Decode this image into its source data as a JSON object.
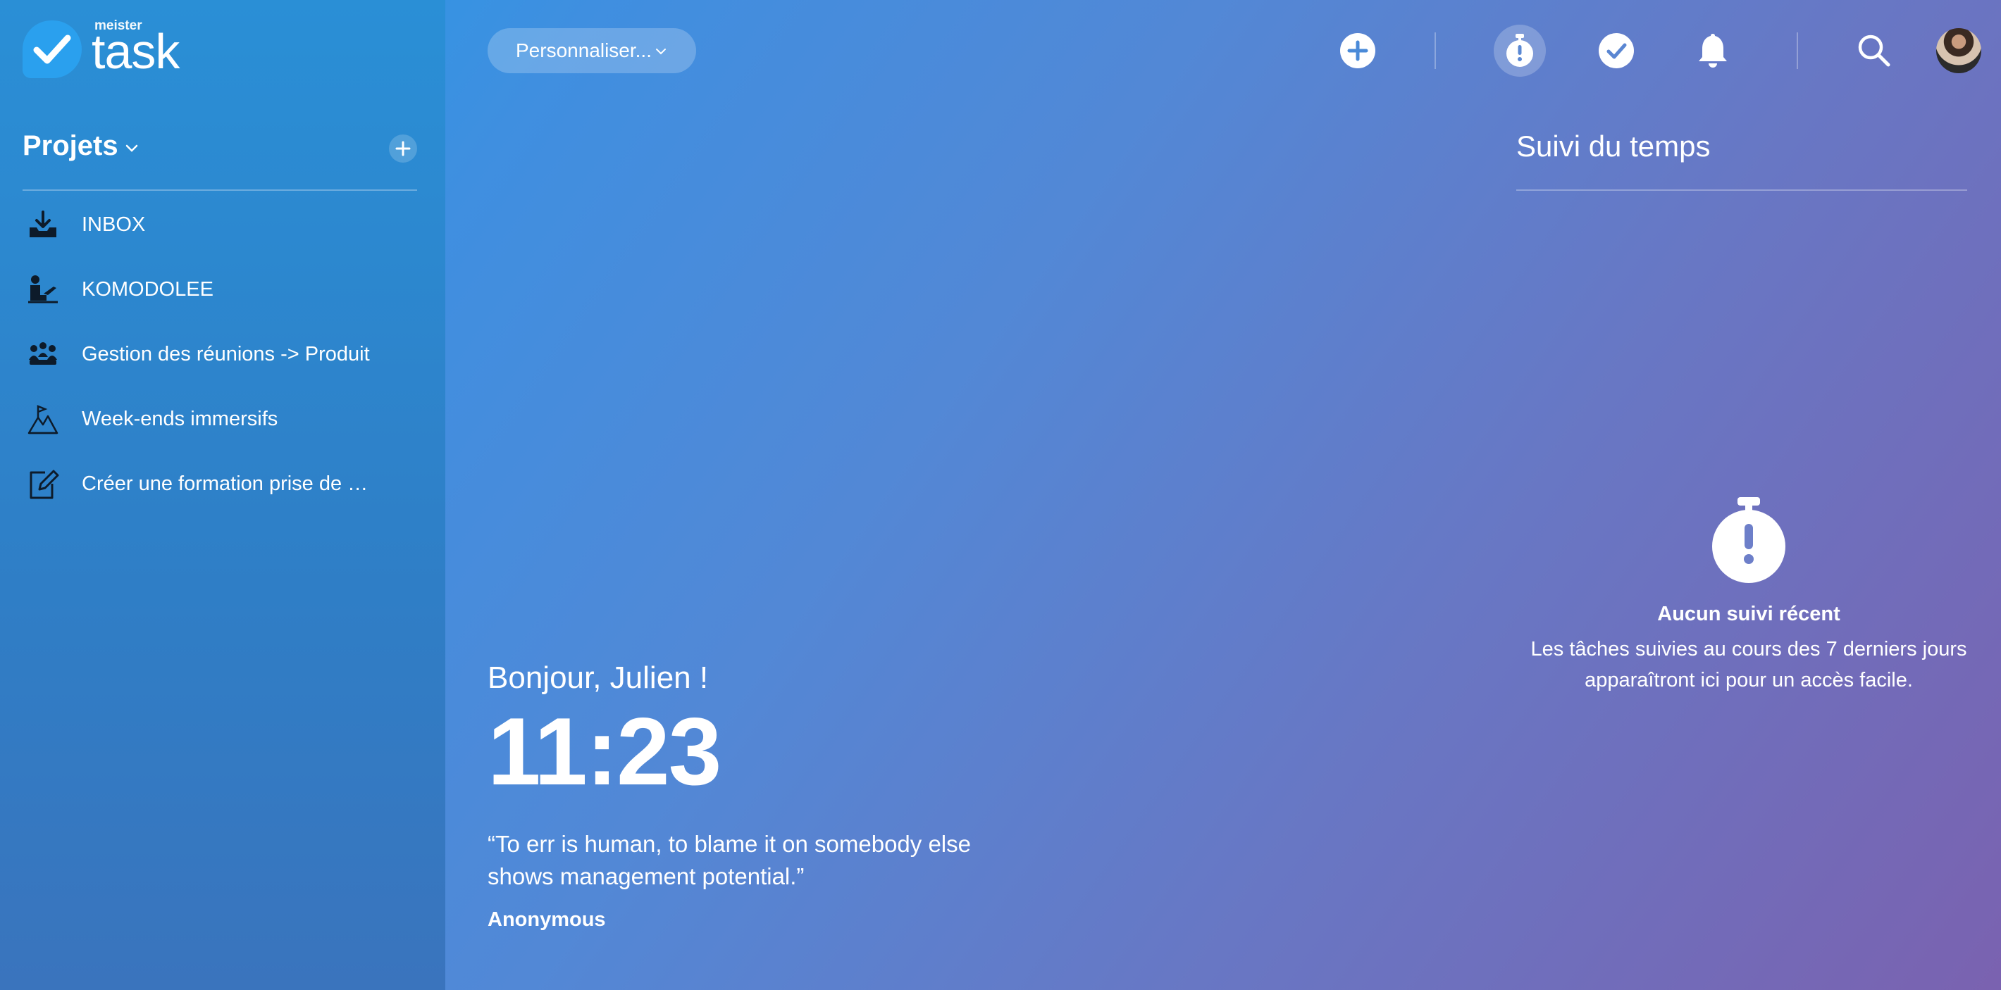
{
  "app": {
    "logo_small": "meister",
    "logo_word": "task",
    "brand_color": "#2aa0ee"
  },
  "sidebar": {
    "projects_label": "Projets",
    "items": [
      {
        "label": "INBOX",
        "icon": "inbox-download-icon"
      },
      {
        "label": "KOMODOLEE",
        "icon": "person-at-desk-icon"
      },
      {
        "label": "Gestion des réunions -> Produit",
        "icon": "meeting-group-icon"
      },
      {
        "label": "Week-ends immersifs",
        "icon": "mountain-flag-icon"
      },
      {
        "label": "Créer une formation prise de …",
        "icon": "edit-note-icon"
      }
    ]
  },
  "topbar": {
    "customize_label": "Personnaliser...",
    "icons": [
      "add-icon",
      "timer-icon",
      "check-icon",
      "bell-icon",
      "search-icon",
      "avatar"
    ]
  },
  "tracking": {
    "title": "Suivi du temps",
    "empty_title": "Aucun suivi récent",
    "empty_text": "Les tâches suivies au cours des 7 derniers jours apparaîtront ici pour un accès facile."
  },
  "welcome": {
    "greeting": "Bonjour, Julien !",
    "time": "11:23",
    "quote": "“To err is human, to blame it on somebody else shows management potential.”",
    "author": "Anonymous"
  }
}
